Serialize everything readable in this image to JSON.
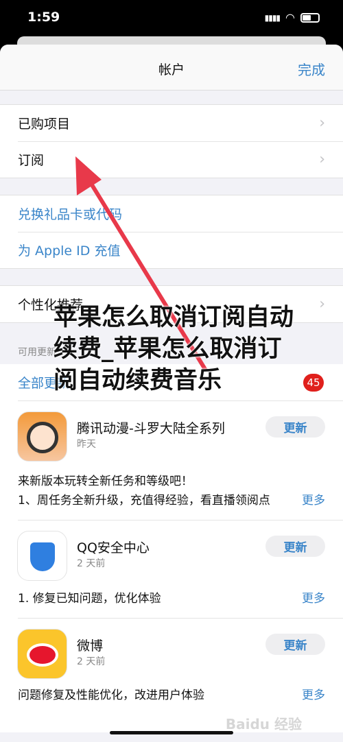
{
  "status": {
    "time": "1:59"
  },
  "header": {
    "title": "帐户",
    "done": "完成"
  },
  "group1": [
    "已购项目",
    "订阅"
  ],
  "group2": [
    "兑换礼品卡或代码",
    "为 Apple ID 充值"
  ],
  "personal": "个性化推荐",
  "updates": {
    "section": "可用更新",
    "all": "全部更新",
    "count": "45"
  },
  "apps": [
    {
      "name": "腾讯动漫-斗罗大陆全系列",
      "date": "昨天",
      "button": "更新",
      "desc1": "来新版本玩转全新任务和等级吧！",
      "desc2": "1、周任务全新升级，充值得经验，看直播领阅点",
      "more": "更多"
    },
    {
      "name": "QQ安全中心",
      "date": "2 天前",
      "button": "更新",
      "desc2": "1. 修复已知问题，优化体验",
      "more": "更多"
    },
    {
      "name": "微博",
      "date": "2 天前",
      "button": "更新",
      "desc2": "问题修复及性能优化，改进用户体验",
      "more": "更多"
    }
  ],
  "overlay_title": "苹果怎么取消订阅自动续费_苹果怎么取消订阅自动续费音乐",
  "watermark": "Baidu 经验",
  "colors": {
    "accent": "#3a85c9",
    "arrow": "#e8394a",
    "badge": "#e0201c"
  }
}
